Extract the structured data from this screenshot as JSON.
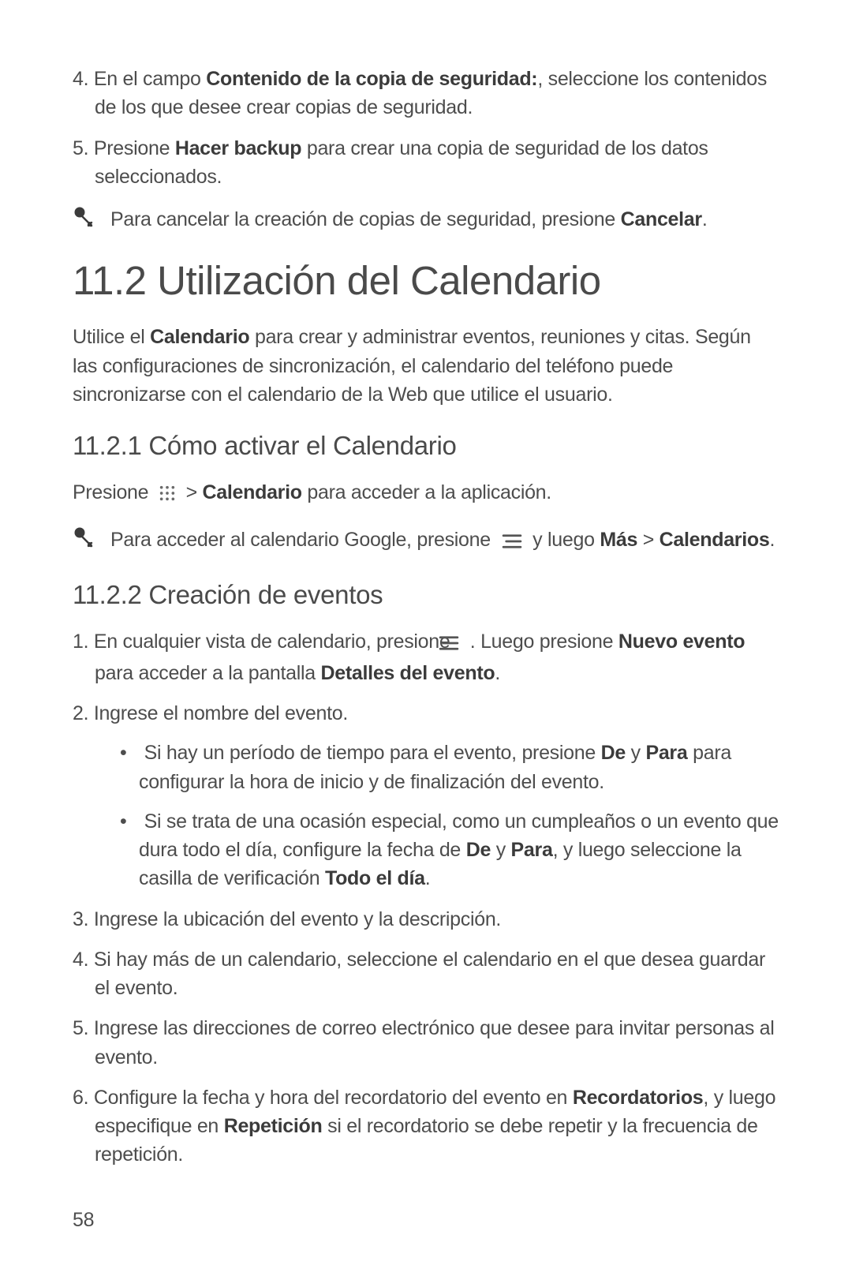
{
  "topList": {
    "item4": {
      "num": "4.",
      "pre": "En el campo ",
      "bold": "Contenido de la copia de seguridad:",
      "post": ", seleccione los contenidos de los que desee crear copias de seguridad."
    },
    "item5": {
      "num": "5.",
      "pre": "Presione ",
      "bold": "Hacer backup",
      "post": " para crear una copia de seguridad de los datos seleccionados."
    }
  },
  "note1": {
    "pre": "Para cancelar la creación de copias de seguridad, presione ",
    "bold": "Cancelar",
    "post": "."
  },
  "h1": "11.2  Utilización del Calendario",
  "intro": {
    "pre": "Utilice el ",
    "bold": "Calendario",
    "post": " para crear y administrar eventos, reuniones y citas. Según las configuraciones de sincronización, el calendario del teléfono puede sincronizarse con el calendario de la Web que utilice el usuario."
  },
  "h2a": "11.2.1  Cómo activar el Calendario",
  "press": {
    "pre": "Presione ",
    "mid": " > ",
    "bold": "Calendario",
    "post": " para acceder a la aplicación."
  },
  "note2": {
    "pre": "Para acceder al calendario Google, presione ",
    "mid": " y luego ",
    "b1": "Más",
    "sep": " > ",
    "b2": "Calendarios",
    "post": "."
  },
  "h2b": "11.2.2  Creación de eventos",
  "ev": {
    "s1": {
      "num": "1.",
      "pre": "En cualquier vista de calendario, presione ",
      "mid": ". Luego presione ",
      "b1": "Nuevo evento",
      "post1": " para acceder a la pantalla ",
      "b2": "Detalles del evento",
      "post2": "."
    },
    "s2": {
      "num": "2.",
      "text": "Ingrese el nombre del evento."
    },
    "s2b1": {
      "pre": "Si hay un período de tiempo para el evento, presione ",
      "b1": "De",
      "mid": " y ",
      "b2": "Para",
      "post": " para configurar la hora de inicio y de finalización del evento."
    },
    "s2b2": {
      "pre": "Si se trata de una ocasión especial, como un cumpleaños o un evento que dura todo el día, configure la fecha de ",
      "b1": "De",
      "mid": " y ",
      "b2": "Para",
      "post1": ", y luego seleccione la casilla de verificación ",
      "b3": "Todo el día",
      "post2": "."
    },
    "s3": {
      "num": "3.",
      "text": "Ingrese la ubicación del evento y la descripción."
    },
    "s4": {
      "num": "4.",
      "text": "Si hay más de un calendario, seleccione el calendario en el que desea guardar el evento."
    },
    "s5": {
      "num": "5.",
      "text": "Ingrese las direcciones de correo electrónico que desee para invitar personas al evento."
    },
    "s6": {
      "num": "6.",
      "pre": "Configure la fecha y hora del recordatorio del evento en ",
      "b1": "Recordatorios",
      "mid": ", y luego especifique en ",
      "b2": "Repetición",
      "post": " si el recordatorio se debe repetir y la frecuencia de repetición."
    }
  },
  "pageNum": "58"
}
